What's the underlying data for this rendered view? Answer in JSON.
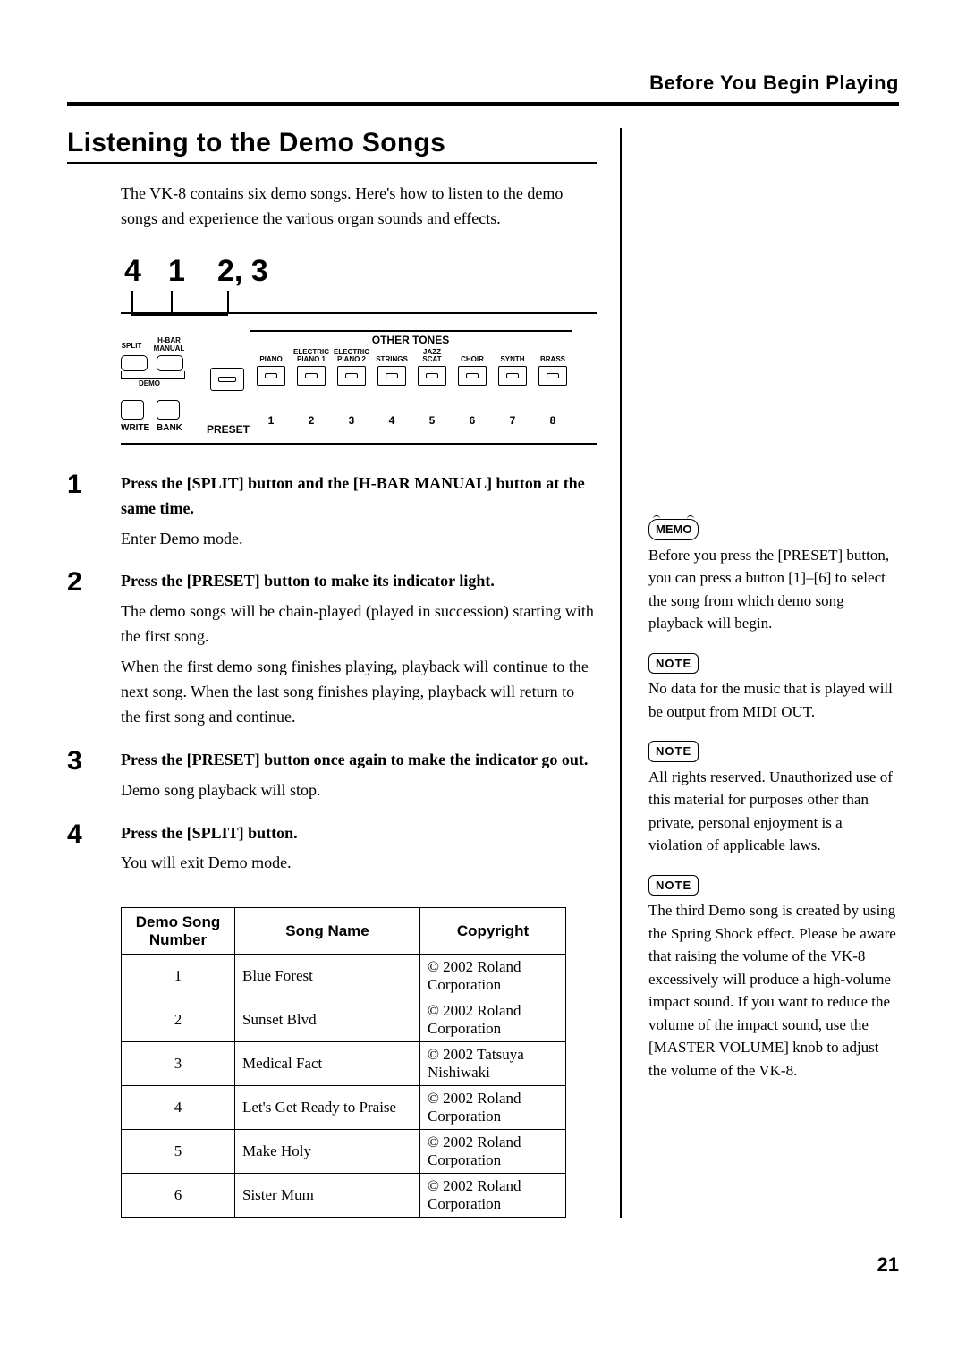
{
  "header_title": "Before You Begin Playing",
  "section_title": "Listening to the Demo Songs",
  "intro": "The VK-8 contains six demo songs. Here's how to listen to the demo songs and experience the various organ sounds and effects.",
  "diagram_numbers": {
    "n4": "4",
    "n1": "1",
    "n23": "2, 3"
  },
  "panel": {
    "other_tones": "OTHER TONES",
    "left_labels": {
      "split": "SPLIT",
      "hbar": "H-BAR\nMANUAL",
      "demo": "DEMO",
      "write": "WRITE",
      "bank": "BANK"
    },
    "preset_word": "PRESET",
    "tone_labels": [
      "PIANO",
      "ELECTRIC\nPIANO 1",
      "ELECTRIC\nPIANO 2",
      "STRINGS",
      "JAZZ\nSCAT",
      "CHOIR",
      "SYNTH",
      "BRASS"
    ],
    "numbers": [
      "1",
      "2",
      "3",
      "4",
      "5",
      "6",
      "7",
      "8"
    ]
  },
  "steps": [
    {
      "num": "1",
      "lead": "Press the [SPLIT] button and the [H-BAR MANUAL] button at the same time.",
      "rest": [
        "Enter Demo mode."
      ]
    },
    {
      "num": "2",
      "lead": "Press the [PRESET] button to make its indicator light.",
      "rest": [
        "The demo songs will be chain-played (played in succession) starting with the first song.",
        "When the first demo song finishes playing, playback will continue to the next song. When the last song finishes playing, playback will return to the first song and continue."
      ]
    },
    {
      "num": "3",
      "lead": "Press the [PRESET] button once again to make the indicator go out.",
      "rest": [
        "Demo song playback will stop."
      ]
    },
    {
      "num": "4",
      "lead": "Press the [SPLIT] button.",
      "rest": [
        "You will exit Demo mode."
      ]
    }
  ],
  "table": {
    "headers": [
      "Demo Song\nNumber",
      "Song Name",
      "Copyright"
    ],
    "rows": [
      [
        "1",
        "Blue Forest",
        "© 2002 Roland Corporation"
      ],
      [
        "2",
        "Sunset Blvd",
        "© 2002 Roland Corporation"
      ],
      [
        "3",
        "Medical Fact",
        "© 2002 Tatsuya Nishiwaki"
      ],
      [
        "4",
        "Let's Get Ready to Praise",
        "© 2002 Roland Corporation"
      ],
      [
        "5",
        "Make Holy",
        "© 2002 Roland Corporation"
      ],
      [
        "6",
        "Sister Mum",
        "© 2002 Roland Corporation"
      ]
    ]
  },
  "sidebar": {
    "memo_label": "MEMO",
    "memo_text": "Before you press the [PRESET] button, you can press a button [1]–[6] to select the song from which demo song playback will begin.",
    "note_label": "NOTE",
    "note1": "No data for the music that is played will be output from MIDI OUT.",
    "note2": "All rights reserved. Unauthorized use of this material for purposes other than private, personal enjoyment is a violation of applicable laws.",
    "note3": "The third Demo song is created by using the Spring Shock effect. Please be aware that raising the volume of the VK-8 excessively will produce a high-volume impact sound. If you want to reduce the volume of the impact sound, use the [MASTER VOLUME] knob to adjust the volume of the VK-8."
  },
  "page_number": "21"
}
